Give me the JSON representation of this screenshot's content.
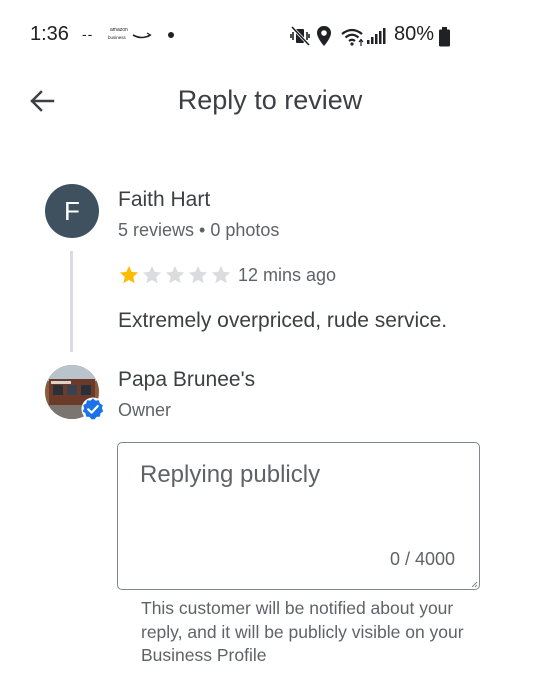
{
  "status_bar": {
    "time": "1:36",
    "dashes": "--",
    "amazon_line1": "amazon",
    "amazon_line2": "business",
    "battery_percent": "80%",
    "icons": [
      "mute-vibrate-icon",
      "location-icon",
      "wifi-icon",
      "signal-icon",
      "battery-icon"
    ]
  },
  "header": {
    "back_icon": "arrow-back-icon",
    "title": "Reply to review"
  },
  "review": {
    "avatar_letter": "F",
    "avatar_color": "#3f515e",
    "reviewer_name": "Faith Hart",
    "reviewer_meta": "5 reviews • 0 photos",
    "rating": 1,
    "rating_max": 5,
    "time_ago": "12 mins ago",
    "text": "Extremely overpriced, rude service."
  },
  "owner": {
    "name": "Papa Brunee's",
    "role": "Owner",
    "verified_color": "#1a73e8"
  },
  "reply": {
    "placeholder": "Replying publicly",
    "value": "",
    "char_count": "0 / 4000"
  },
  "notice": "This customer will be notified about your reply, and it will be publicly visible on your Business Profile",
  "colors": {
    "star_filled": "#fbbc04",
    "star_empty": "#dadce0"
  }
}
